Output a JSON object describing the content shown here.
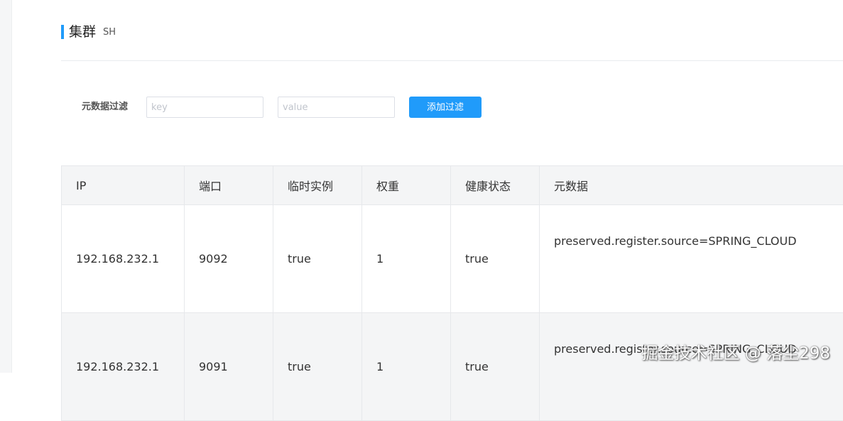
{
  "header": {
    "title": "集群",
    "subtitle": "SH"
  },
  "filter": {
    "label": "元数据过滤",
    "key_placeholder": "key",
    "value_placeholder": "value",
    "add_label": "添加过滤"
  },
  "table": {
    "headers": [
      "IP",
      "端口",
      "临时实例",
      "权重",
      "健康状态",
      "元数据"
    ],
    "rows": [
      [
        "192.168.232.1",
        "9092",
        "true",
        "1",
        "true",
        "preserved.register.source=SPRING_CLOUD"
      ],
      [
        "192.168.232.1",
        "9091",
        "true",
        "1",
        "true",
        "preserved.register.source=SPRING_CLOUD"
      ]
    ]
  },
  "watermark": "掘金技术社区 @ 落尘298",
  "colors": {
    "accent": "#209bfa",
    "header_bg": "#f4f5f6",
    "border": "#e6e8eb"
  }
}
